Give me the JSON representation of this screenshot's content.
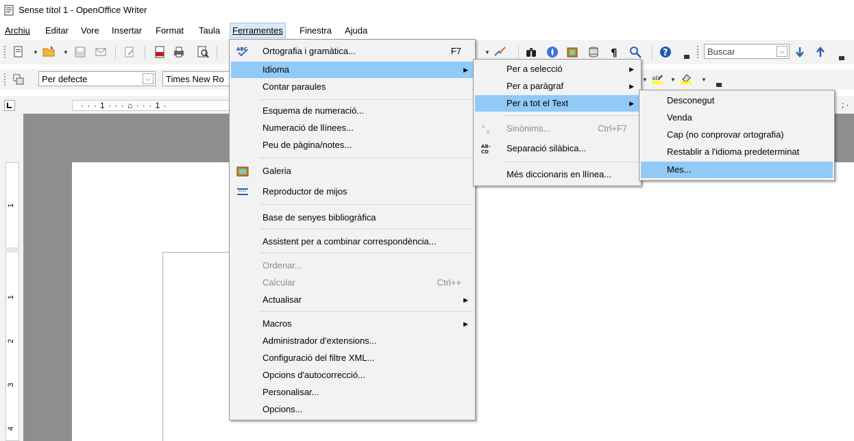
{
  "window": {
    "title": "Sense títol 1 - OpenOffice Writer"
  },
  "menubar": {
    "items": [
      {
        "label": "Archiu"
      },
      {
        "label": "Editar"
      },
      {
        "label": "Vore"
      },
      {
        "label": "Insertar"
      },
      {
        "label": "Format"
      },
      {
        "label": "Taula"
      },
      {
        "label": "Ferramentes"
      },
      {
        "label": "Finestra"
      },
      {
        "label": "Ajuda"
      }
    ]
  },
  "toolbar": {
    "search_placeholder": "Buscar",
    "paragraph_style": "Per defecte",
    "font_name": "Times New Ro"
  },
  "ruler": {
    "top_marks": "· · · 1 · · · ⌂ · · · 1 ·",
    "left_marks": [
      "1",
      "1",
      "2",
      "3",
      "4"
    ]
  },
  "tools_menu": {
    "items": [
      {
        "label": "Ortografia i gramàtica...",
        "shortcut": "F7",
        "icon": "spellcheck-icon"
      },
      {
        "label": "Idioma",
        "submenu": true,
        "highlighted": true
      },
      {
        "label": "Contar paraules"
      },
      {
        "label": "Esquema de numeració..."
      },
      {
        "label": "Numeració de llínees..."
      },
      {
        "label": "Peu de pàgina/notes..."
      },
      {
        "label": "Galeria",
        "icon": "gallery-icon"
      },
      {
        "label": "Reproductor de mijos",
        "icon": "media-player-icon"
      },
      {
        "label": "Base de senyes bibliogràfica"
      },
      {
        "label": "Assistent per a combinar correspondència..."
      },
      {
        "label": "Ordenar...",
        "disabled": true
      },
      {
        "label": "Calcular",
        "shortcut": "Ctrl++",
        "disabled": true
      },
      {
        "label": "Actualisar",
        "submenu": true
      },
      {
        "label": "Macros",
        "submenu": true
      },
      {
        "label": "Administrador d'extensions..."
      },
      {
        "label": "Configuració del filtre XML..."
      },
      {
        "label": "Opcions d'autocorrecció..."
      },
      {
        "label": "Personalisar..."
      },
      {
        "label": "Opcions..."
      }
    ]
  },
  "language_menu": {
    "items": [
      {
        "label": "Per a selecció",
        "submenu": true
      },
      {
        "label": "Per a paràgraf",
        "submenu": true
      },
      {
        "label": "Per a tot el Text",
        "submenu": true,
        "highlighted": true
      },
      {
        "label": "Sinònims...",
        "shortcut": "Ctrl+F7",
        "disabled": true,
        "icon": "thesaurus-icon"
      },
      {
        "label": "Separació silàbica...",
        "icon": "hyphenation-icon"
      },
      {
        "label": "Més diccionaris en llínea..."
      }
    ]
  },
  "text_language_menu": {
    "items": [
      {
        "label": "Desconegut"
      },
      {
        "label": "Venda"
      },
      {
        "label": "Cap (no conprovar ortografia)"
      },
      {
        "label": "Restablir a l'idioma predeterminat"
      },
      {
        "label": "Mes...",
        "highlighted": true
      }
    ]
  },
  "colors": {
    "menu_highlight": "#91c9f7",
    "menubar_open": "#dbe9f7",
    "doc_background": "#8e8e8e"
  }
}
